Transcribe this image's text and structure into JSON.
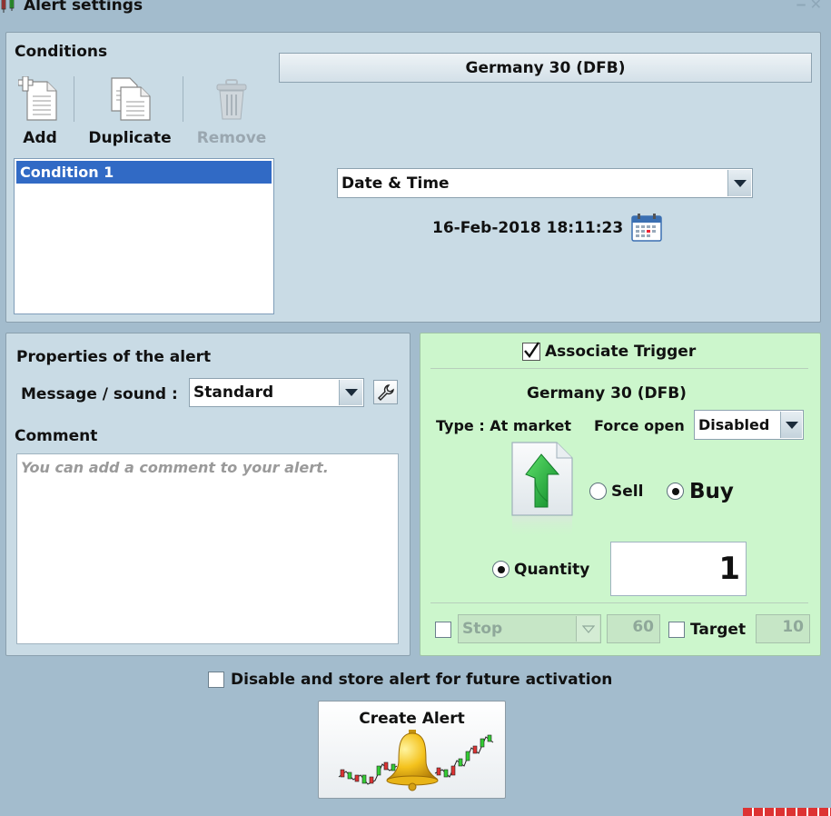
{
  "window": {
    "title": "Alert settings"
  },
  "conditions": {
    "heading": "Conditions",
    "toolbar": {
      "add_label": "Add",
      "duplicate_label": "Duplicate",
      "remove_label": "Remove"
    },
    "items": [
      "Condition 1"
    ],
    "instrument": "Germany 30 (DFB)",
    "condition_type": "Date & Time",
    "datetime": "16-Feb-2018 18:11:23"
  },
  "properties": {
    "heading": "Properties of the alert",
    "message_label": "Message / sound :",
    "message_value": "Standard",
    "comment_label": "Comment",
    "comment_placeholder": "You can add a comment to your alert."
  },
  "trigger": {
    "associate_label": "Associate Trigger",
    "associate_checked": true,
    "instrument": "Germany 30 (DFB)",
    "type_text": "Type : At market",
    "force_open_label": "Force open",
    "force_open_value": "Disabled",
    "sell_label": "Sell",
    "buy_label": "Buy",
    "selected_side": "Buy",
    "quantity_label": "Quantity",
    "quantity_value": "1",
    "stop_label": "Stop",
    "stop_value": "60",
    "target_label": "Target",
    "target_value": "10"
  },
  "footer": {
    "disable_label": "Disable and store alert for future activation",
    "create_label": "Create Alert"
  },
  "colors": {
    "background": "#a3bccd",
    "panel": "#c9dbe5",
    "trigger_panel": "#ccf6cc",
    "selection": "#316ac5",
    "arrow_green": "#1fa63a"
  }
}
